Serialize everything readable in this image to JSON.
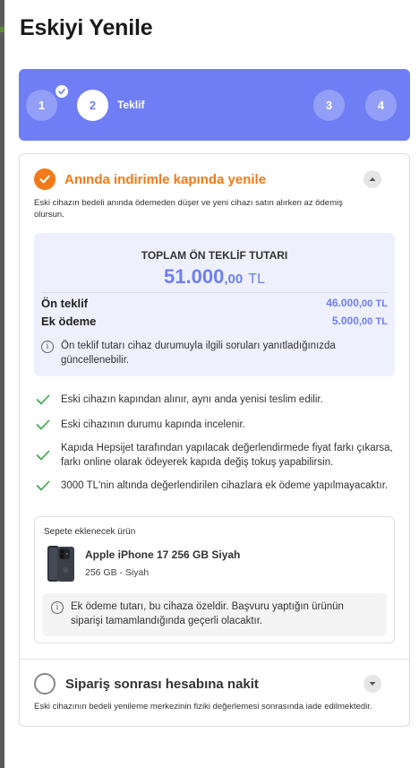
{
  "page": {
    "title": "Eskiyi Yenile"
  },
  "stepper": {
    "steps": [
      {
        "number": "1",
        "state": "completed"
      },
      {
        "number": "2",
        "state": "active",
        "label": "Teklif"
      },
      {
        "number": "3",
        "state": "upcoming"
      },
      {
        "number": "4",
        "state": "upcoming"
      }
    ],
    "color": "#6f7ef5"
  },
  "option1": {
    "title": "Anında indirimle kapında yenile",
    "description": "Eski cihazın bedeli anında ödemeden düşer ve yeni cihazı satın alırken az ödemiş olursun.",
    "selected": true,
    "accent": "#f27a1a",
    "offer": {
      "label": "TOPLAM ÖN TEKLİF TUTARI",
      "total_int": "51.000",
      "total_dec": ",00",
      "currency": "TL",
      "rows": [
        {
          "label": "Ön teklif",
          "int": "46.000",
          "dec": ",00",
          "currency": "TL"
        },
        {
          "label": "Ek ödeme",
          "int": "5.000",
          "dec": ",00",
          "currency": "TL"
        }
      ],
      "note": "Ön teklif tutarı cihaz durumuyla ilgili soruları yanıtladığınızda güncellenebilir."
    },
    "features": [
      "Eski cihazın kapından alınır, aynı anda yenisi teslim edilir.",
      "Eski cihazının durumu kapında incelenir.",
      "Kapıda Hepsijet tarafından yapılacak değerlendirmede fiyat farkı çıkarsa, farkı online olarak ödeyerek kapıda değiş tokuş yapabilirsin.",
      "3000 TL'nin altında değerlendirilen cihazlara ek ödeme yapılmayacaktır."
    ],
    "product": {
      "label": "Sepete eklenecek ürün",
      "name": "Apple iPhone 17 256 GB Siyah",
      "variant": "256 GB - Siyah",
      "note": "Ek ödeme tutarı, bu cihaza özeldir. Başvuru yaptığın ürünün siparişi tamamlandığında geçerli olacaktır."
    }
  },
  "option2": {
    "title": "Sipariş sonrası hesabına nakit",
    "description": "Eski cihazının bedeli yenileme merkezinin fiziki değerlemesi sonrasında iade edilmektedir.",
    "selected": false
  },
  "icons": {
    "check": "check-icon",
    "info": "info-icon",
    "chevron_up": "chevron-up-icon",
    "chevron_down": "chevron-down-icon"
  }
}
